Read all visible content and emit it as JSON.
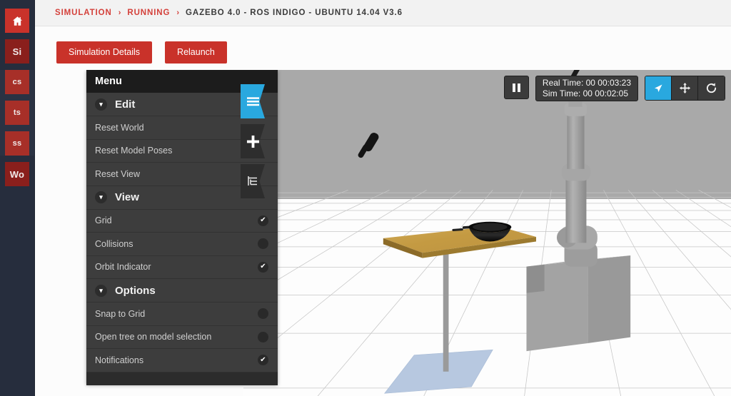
{
  "rail": {
    "items": [
      {
        "name": "home",
        "label": "",
        "icon": "home-icon",
        "style": "home"
      },
      {
        "name": "simulations",
        "label": "Si",
        "icon": "",
        "style": "dark"
      },
      {
        "name": "cs",
        "label": "cs",
        "icon": "",
        "style": "mid"
      },
      {
        "name": "ts",
        "label": "ts",
        "icon": "",
        "style": "mid"
      },
      {
        "name": "ss",
        "label": "ss",
        "icon": "",
        "style": "mid"
      },
      {
        "name": "worlds",
        "label": "Wo",
        "icon": "",
        "style": "dark"
      }
    ]
  },
  "header": {
    "breadcrumb": [
      {
        "label": "SIMULATION",
        "active": true
      },
      {
        "label": "RUNNING",
        "active": true
      },
      {
        "label": "GAZEBO 4.0 - ROS INDIGO - UBUNTU 14.04 V3.6",
        "active": false
      }
    ],
    "separator": "›"
  },
  "toolbar": {
    "simulation_details_label": "Simulation Details",
    "relaunch_label": "Relaunch"
  },
  "menu": {
    "title": "Menu",
    "caret": "⌄",
    "sections": [
      {
        "title": "Edit",
        "rows": [
          {
            "label": "Reset World",
            "toggle": null
          },
          {
            "label": "Reset Model Poses",
            "toggle": null
          },
          {
            "label": "Reset View",
            "toggle": null
          }
        ]
      },
      {
        "title": "View",
        "rows": [
          {
            "label": "Grid",
            "toggle": true
          },
          {
            "label": "Collisions",
            "toggle": false
          },
          {
            "label": "Orbit Indicator",
            "toggle": true
          }
        ]
      },
      {
        "title": "Options",
        "rows": [
          {
            "label": "Snap to Grid",
            "toggle": false
          },
          {
            "label": "Open tree on model selection",
            "toggle": false
          },
          {
            "label": "Notifications",
            "toggle": true
          }
        ]
      }
    ],
    "check_glyph": "✔"
  },
  "sidetabs": [
    {
      "name": "menu-tab",
      "icon": "hamburger-icon",
      "active": true
    },
    {
      "name": "insert-tab",
      "icon": "plus-icon",
      "active": false
    },
    {
      "name": "tree-tab",
      "icon": "tree-icon",
      "active": false
    }
  ],
  "viewport": {
    "pause_label": "pause-icon",
    "real_time_label": "Real Time: 00 00:03:23",
    "sim_time_label": "Sim Time: 00 00:02:05",
    "modes": [
      {
        "name": "select-mode",
        "icon": "cursor-icon",
        "active": true
      },
      {
        "name": "translate-mode",
        "icon": "move-icon",
        "active": false
      },
      {
        "name": "rotate-mode",
        "icon": "rotate-icon",
        "active": false
      }
    ]
  },
  "colors": {
    "accent_red": "#c9322a",
    "rail_bg": "#262d3d",
    "panel_bg": "#3d3d3d",
    "active_blue": "#29a8df",
    "sky": "#a9a9a9",
    "ground": "#fdfdfd",
    "table_wood": "#c7a049",
    "robot_gray": "#a0a0a0",
    "base_plate_blue": "#b6c8e0"
  },
  "scene": {
    "objects": [
      "table",
      "bowl",
      "utensil",
      "floating-utensil",
      "robot-arm",
      "pedestal",
      "base-plate"
    ]
  }
}
